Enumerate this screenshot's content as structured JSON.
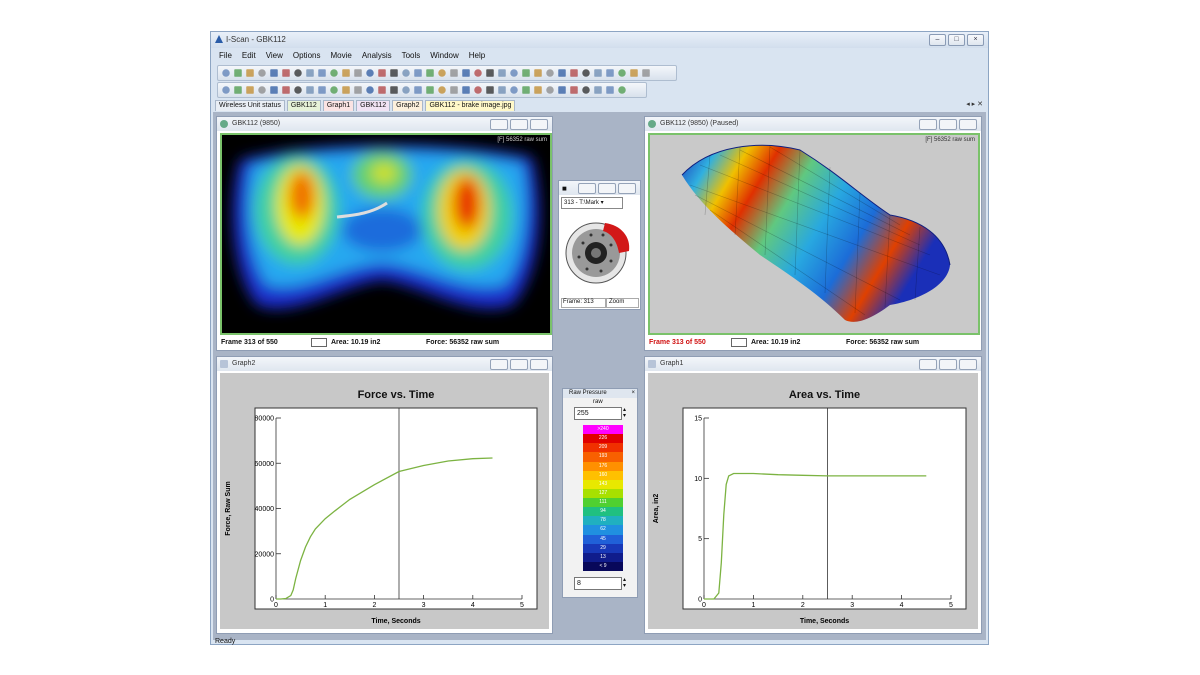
{
  "app": {
    "title": "I-Scan - GBK112",
    "menu": [
      "File",
      "Edit",
      "View",
      "Options",
      "Movie",
      "Analysis",
      "Tools",
      "Window",
      "Help"
    ],
    "tabs": [
      "Wireless Unit status",
      "GBK112",
      "Graph1",
      "GBK112",
      "Graph2",
      "GBK112 - brake image.jpg"
    ],
    "active_tab_index": 5,
    "status": "Ready"
  },
  "pressure_2d": {
    "title": "GBK112 (9850)",
    "overlay": "[F] 56352 raw sum",
    "frame": "Frame 313 of 550",
    "area": "Area: 10.19 in2",
    "force": "Force: 56352 raw sum"
  },
  "pressure_3d": {
    "title": "GBK112 (9850) (Paused)",
    "overlay": "[F] 56352 raw sum",
    "frame": "Frame 313 of 550",
    "area": "Area: 10.19 in2",
    "force": "Force: 56352 raw sum"
  },
  "camera": {
    "dropdown": "313 - T:\\Mark",
    "frame": "Frame: 313",
    "zoom": "Zoom"
  },
  "legend": {
    "title": "Raw Pressure",
    "unit": "raw",
    "max_value": "255",
    "min_value": "8",
    "scale_labels": [
      ">240",
      "226",
      "209",
      "193",
      "176",
      "160",
      "143",
      "127",
      "111",
      "94",
      "78",
      "62",
      "45",
      "29",
      "13",
      "< 9"
    ],
    "colors": [
      "#ff00ff",
      "#e00000",
      "#f03000",
      "#f86000",
      "#ff9000",
      "#ffc000",
      "#e8e800",
      "#a8e000",
      "#50d030",
      "#20c080",
      "#20b0c0",
      "#2090e0",
      "#2060d8",
      "#1838b8",
      "#101c8c",
      "#08085a"
    ]
  },
  "graph_force": {
    "window_title": "Graph2",
    "chart_data": {
      "type": "line",
      "title": "Force vs. Time",
      "xlabel": "Time, Seconds",
      "ylabel": "Force, Raw Sum",
      "xlim": [
        0,
        5
      ],
      "ylim": [
        0,
        80000
      ],
      "xticks": [
        "0",
        "1",
        "2",
        "3",
        "4",
        "5"
      ],
      "yticks": [
        "0",
        "20000",
        "40000",
        "60000",
        "80000"
      ],
      "cursor_x": 2.5,
      "series": [
        {
          "x": [
            0.0,
            0.1,
            0.2,
            0.3,
            0.35,
            0.4,
            0.5,
            0.6,
            0.7,
            0.8,
            1.0,
            1.2,
            1.5,
            2.0,
            2.5,
            3.0,
            3.5,
            4.0,
            4.4
          ],
          "y": [
            0,
            0,
            200,
            1500,
            4000,
            9000,
            17000,
            23000,
            27500,
            31000,
            35500,
            39000,
            44000,
            50500,
            56352,
            59000,
            61000,
            62000,
            62300
          ]
        }
      ]
    }
  },
  "graph_area": {
    "window_title": "Graph1",
    "chart_data": {
      "type": "line",
      "title": "Area vs. Time",
      "xlabel": "Time, Seconds",
      "ylabel": "Area, in2",
      "xlim": [
        0,
        5
      ],
      "ylim": [
        0,
        15
      ],
      "xticks": [
        "0",
        "1",
        "2",
        "3",
        "4",
        "5"
      ],
      "yticks": [
        "0",
        "5",
        "10",
        "15"
      ],
      "cursor_x": 2.5,
      "series": [
        {
          "x": [
            0.0,
            0.2,
            0.3,
            0.35,
            0.4,
            0.45,
            0.5,
            0.6,
            0.8,
            1.0,
            1.5,
            2.0,
            2.5,
            3.0,
            3.5,
            4.0,
            4.5
          ],
          "y": [
            0,
            0,
            0.5,
            3,
            7,
            9.5,
            10.2,
            10.4,
            10.4,
            10.4,
            10.3,
            10.25,
            10.2,
            10.2,
            10.2,
            10.2,
            10.2
          ]
        }
      ]
    }
  }
}
